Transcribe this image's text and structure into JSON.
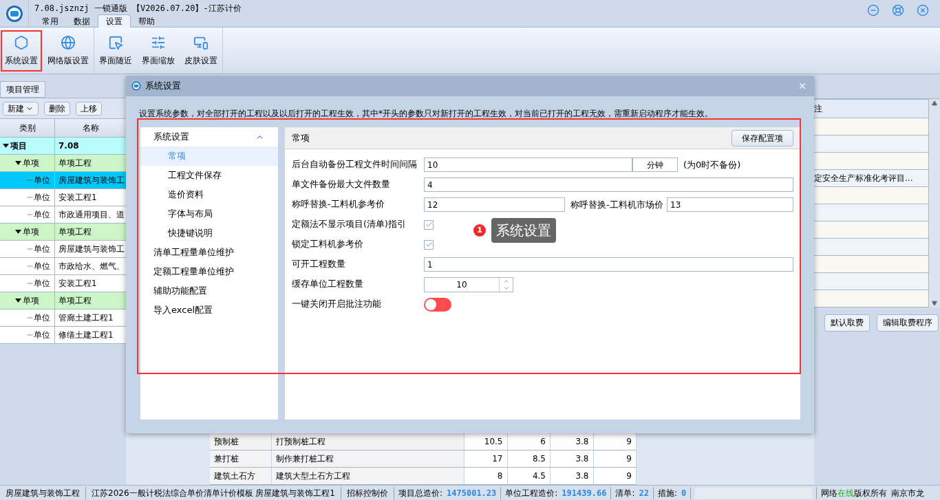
{
  "window": {
    "title": "7.08.jsznzj 一锁通版 【V2026.07.20】-江苏计价",
    "tabs": [
      {
        "label": "常用",
        "selected": false
      },
      {
        "label": "数据",
        "selected": false
      },
      {
        "label": "设置",
        "selected": true
      },
      {
        "label": "帮助",
        "selected": false
      }
    ]
  },
  "ribbon": {
    "groups": [
      [
        {
          "label": "系统设置",
          "highlighted": true
        },
        {
          "label": "网络版设置",
          "highlighted": false
        }
      ],
      [
        {
          "label": "界面随近",
          "highlighted": false
        },
        {
          "label": "界面缩放",
          "highlighted": false
        },
        {
          "label": "皮肤设置",
          "highlighted": false
        }
      ]
    ]
  },
  "project_panel": {
    "tab": "项目管理",
    "toolbar": [
      {
        "label": "新建",
        "dropdown": true
      },
      {
        "label": "删除",
        "dropdown": false
      },
      {
        "label": "上移",
        "dropdown": false
      }
    ],
    "columns": [
      "类别",
      "名称"
    ],
    "tree": [
      {
        "kind": "project",
        "category": "项目",
        "name": "7.08",
        "selected": false,
        "children": [
          {
            "kind": "item",
            "category": "单项",
            "name": "单项工程",
            "selected": false,
            "children": [
              {
                "kind": "unit",
                "category": "单位",
                "name": "房屋建筑与装饰工",
                "selected": true
              },
              {
                "kind": "unit",
                "category": "单位",
                "name": "安装工程1",
                "selected": false
              },
              {
                "kind": "unit",
                "category": "单位",
                "name": "市政通用项目、道",
                "selected": false
              }
            ]
          },
          {
            "kind": "item",
            "category": "单项",
            "name": "单项工程",
            "selected": false,
            "children": [
              {
                "kind": "unit",
                "category": "单位",
                "name": "房屋建筑与装饰工",
                "selected": false
              },
              {
                "kind": "unit",
                "category": "单位",
                "name": "市政给水、燃气、",
                "selected": false
              },
              {
                "kind": "unit",
                "category": "单位",
                "name": "安装工程1",
                "selected": false
              }
            ]
          },
          {
            "kind": "item",
            "category": "单项",
            "name": "单项工程",
            "selected": false,
            "children": [
              {
                "kind": "unit",
                "category": "单位",
                "name": "管廊土建工程1",
                "selected": false
              },
              {
                "kind": "unit",
                "category": "单位",
                "name": "修缮土建工程1",
                "selected": false
              }
            ]
          }
        ]
      }
    ]
  },
  "fee_panel": {
    "header": "注",
    "note": "定安全生产标准化考评目...",
    "buttons": [
      "默认取费",
      "编辑取费程序"
    ]
  },
  "quantity_table": {
    "rows": [
      [
        "预制桩",
        "打预制桩工程",
        "10.5",
        "6",
        "3.8",
        "9"
      ],
      [
        "兼打桩",
        "制作兼打桩工程",
        "17",
        "8.5",
        "3.8",
        "9"
      ],
      [
        "建筑土石方",
        "建筑大型土石方工程",
        "8",
        "4.5",
        "3.8",
        "9"
      ]
    ]
  },
  "dialog": {
    "title": "系统设置",
    "description": "设置系统参数，对全部打开的工程以及以后打开的工程生效，其中*开头的参数只对新打开的工程生效，对当前已打开的工程无效，需重新启动程序才能生效。",
    "nav": [
      {
        "label": "系统设置",
        "expanded": true,
        "children": [
          {
            "label": "常项",
            "selected": true
          },
          {
            "label": "工程文件保存",
            "selected": false
          },
          {
            "label": "造价资料",
            "selected": false
          },
          {
            "label": "字体与布局",
            "selected": false
          },
          {
            "label": "快捷键说明",
            "selected": false
          }
        ]
      },
      {
        "label": "清单工程量单位维护"
      },
      {
        "label": "定额工程量单位维护"
      },
      {
        "label": "辅助功能配置"
      },
      {
        "label": "导入excel配置"
      }
    ],
    "section_title": "常项",
    "save_button": "保存配置项",
    "fields": [
      {
        "kind": "text",
        "label": "后台自动备份工程文件时间间隔",
        "value": "10",
        "unit": "分钟",
        "note": "(为0时不备份)"
      },
      {
        "kind": "text",
        "label": "单文件备份最大文件数量",
        "value": "4"
      },
      {
        "kind": "pair",
        "label": "称呼替换-工料机参考价",
        "value": "12",
        "label2": "称呼替换-工料机市场价",
        "value2": "13"
      },
      {
        "kind": "checkbox",
        "label": "定额法不显示项目(清单)指引",
        "checked": true
      },
      {
        "kind": "checkbox",
        "label": "锁定工料机参考价",
        "checked": true
      },
      {
        "kind": "text",
        "label": "可开工程数量",
        "value": "1"
      },
      {
        "kind": "spinner",
        "label": "缓存单位工程数量",
        "value": "10"
      },
      {
        "kind": "toggle",
        "label": "一键关闭开启批注功能",
        "on": false
      }
    ],
    "callout": {
      "number": "1",
      "text": "系统设置"
    }
  },
  "status_bar": {
    "items": [
      "房屋建筑与装饰工程",
      "江苏2026一般计税法综合单价清单计价模板 房屋建筑与装饰工程1",
      "招标控制价"
    ],
    "totals": [
      {
        "label": "项目总造价:",
        "value": "1475001.23"
      },
      {
        "label": "单位工程造价:",
        "value": "191439.66"
      },
      {
        "label": "清单:",
        "value": "22"
      },
      {
        "label": "措施:",
        "value": "0"
      }
    ],
    "copyright": {
      "before": "网络",
      "online": "在线",
      "after": "版权所有"
    },
    "company": "南京市龙"
  }
}
